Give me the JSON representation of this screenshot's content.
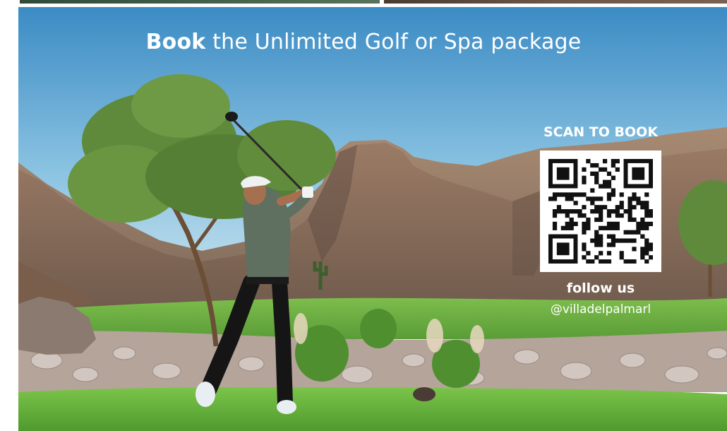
{
  "headline": {
    "bold": "Book",
    "rest": " the Unlimited Golf or Spa package"
  },
  "qr": {
    "label": "SCAN TO BOOK"
  },
  "social": {
    "follow": "follow us",
    "handle": "@villadelpalmarl"
  },
  "colors": {
    "sky_top": "#3f8fc7",
    "sky_bottom": "#bfe0ee",
    "mountain": "#8a6e5c",
    "grass": "#6fb24a",
    "text": "#ffffff"
  }
}
